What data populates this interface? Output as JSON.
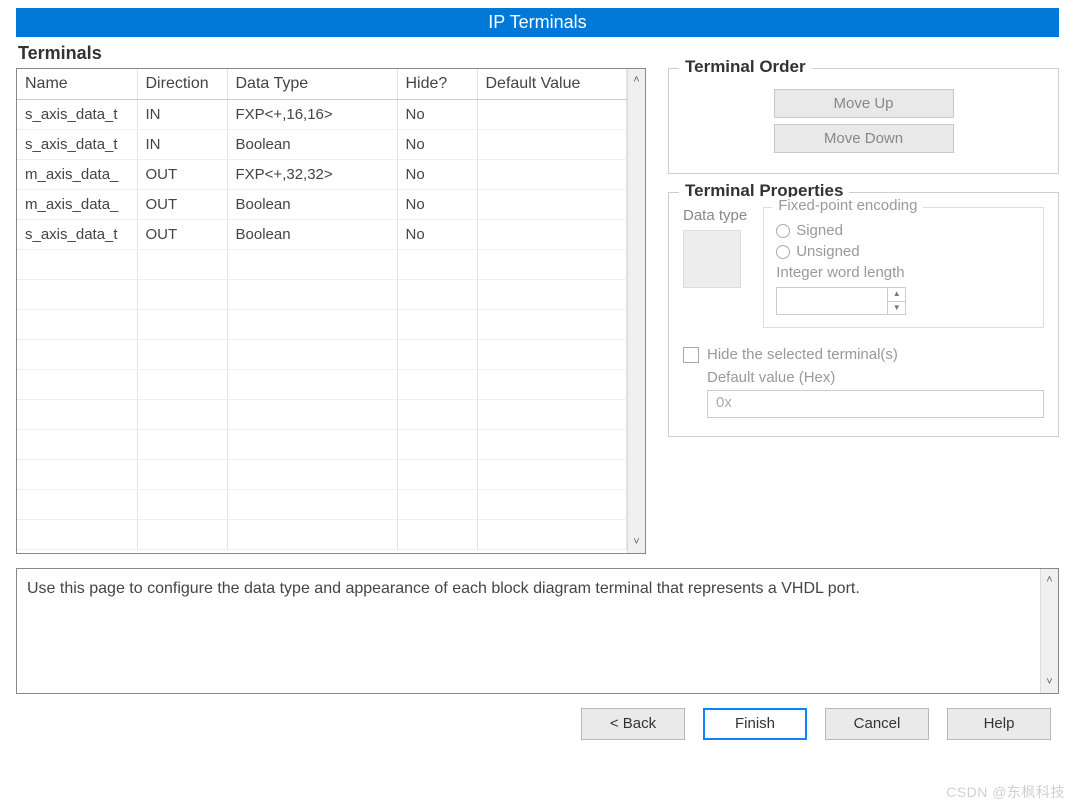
{
  "header": {
    "title": "IP Terminals"
  },
  "terminals": {
    "section_label": "Terminals",
    "columns": {
      "name": "Name",
      "direction": "Direction",
      "data_type": "Data Type",
      "hide": "Hide?",
      "default_value": "Default Value"
    },
    "rows": [
      {
        "name": "s_axis_data_t",
        "direction": "IN",
        "data_type": "FXP<+,16,16>",
        "hide": "No",
        "default_value": ""
      },
      {
        "name": "s_axis_data_t",
        "direction": "IN",
        "data_type": "Boolean",
        "hide": "No",
        "default_value": ""
      },
      {
        "name": "m_axis_data_",
        "direction": "OUT",
        "data_type": "FXP<+,32,32>",
        "hide": "No",
        "default_value": ""
      },
      {
        "name": "m_axis_data_",
        "direction": "OUT",
        "data_type": "Boolean",
        "hide": "No",
        "default_value": ""
      },
      {
        "name": "s_axis_data_t",
        "direction": "OUT",
        "data_type": "Boolean",
        "hide": "No",
        "default_value": ""
      }
    ],
    "blank_row_count": 10
  },
  "terminal_order": {
    "legend": "Terminal Order",
    "move_up": "Move Up",
    "move_down": "Move Down"
  },
  "terminal_properties": {
    "legend": "Terminal Properties",
    "data_type_label": "Data type",
    "encoding": {
      "legend": "Fixed-point encoding",
      "signed": "Signed",
      "unsigned": "Unsigned",
      "iwl_label": "Integer word length",
      "iwl_value": ""
    },
    "hide_checkbox_label": "Hide the selected terminal(s)",
    "default_value_label": "Default value (Hex)",
    "default_value_text": "0x"
  },
  "description": {
    "text": "Use this page to configure the data type and appearance of each block diagram terminal that represents a VHDL port."
  },
  "buttons": {
    "back": "< Back",
    "finish": "Finish",
    "cancel": "Cancel",
    "help": "Help"
  },
  "watermark": "CSDN @东枫科技"
}
